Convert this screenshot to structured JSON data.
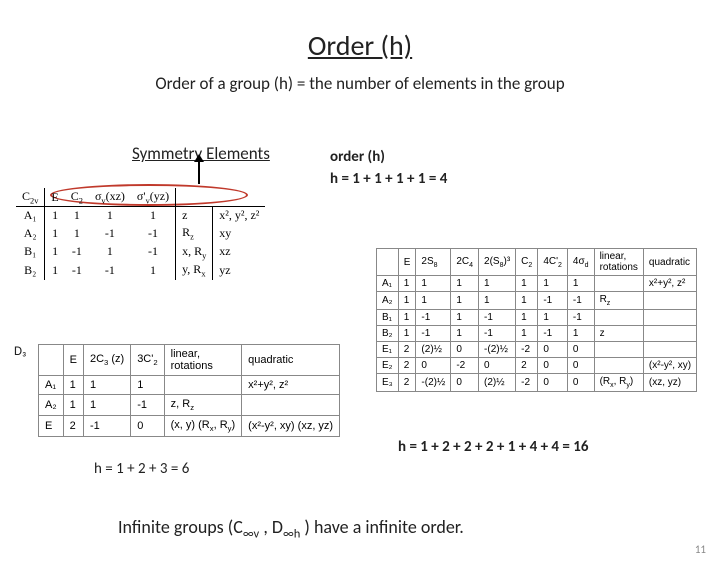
{
  "title": "Order (h)",
  "subtitle": "Order of a group (h) = the number of elements in the group",
  "sym_label": "Symmetry Elements",
  "order_label": "order (h)",
  "eq1": "h = 1 + 1 + 1 + 1 = 4",
  "d3_label": "D₃",
  "eq2": "h = 1 + 2 + 2 + 2 + 1 + 4 + 4 = 16",
  "eq3": "h = 1 + 2 + 3  = 6",
  "infinite_html": "Infinite groups (C<sub>∞v</sub> , D<sub>∞h</sub> ) have a infinite order.",
  "pagenum": "11",
  "c2v": {
    "hdr_html": [
      "C<sub>2v</sub>",
      "E",
      "C<sub>2</sub>",
      "σ<sub>v</sub>(xz)",
      "σ'<sub>v</sub>(yz)",
      "",
      ""
    ],
    "rows": [
      {
        "lbl": "A₁",
        "c": [
          "1",
          "1",
          "1",
          "1"
        ],
        "f1": "z",
        "f2": "x², y², z²"
      },
      {
        "lbl": "A₂",
        "c": [
          "1",
          "1",
          "-1",
          "-1"
        ],
        "f1": "R<sub>z</sub>",
        "f2": "xy"
      },
      {
        "lbl": "B₁",
        "c": [
          "1",
          "-1",
          "1",
          "-1"
        ],
        "f1": "x, R<sub>y</sub>",
        "f2": "xz"
      },
      {
        "lbl": "B₂",
        "c": [
          "1",
          "-1",
          "-1",
          "1"
        ],
        "f1": "y, R<sub>x</sub>",
        "f2": "yz"
      }
    ]
  },
  "d3": {
    "hdr_html": [
      "",
      "E",
      "2C<sub>3</sub> (z)",
      "3C'<sub>2</sub>",
      "linear,<br>rotations",
      "quadratic"
    ],
    "rows": [
      {
        "lbl": "A₁",
        "c": [
          "1",
          "1",
          "1"
        ],
        "f1": "",
        "f2": "x²+y², z²"
      },
      {
        "lbl": "A₂",
        "c": [
          "1",
          "1",
          "-1"
        ],
        "f1": "z, R<sub>z</sub>",
        "f2": ""
      },
      {
        "lbl": "E",
        "c": [
          "2",
          "-1",
          "0"
        ],
        "f1": "(x, y) (R<sub>x</sub>, R<sub>y</sub>)",
        "f2": "(x²-y², xy) (xz, yz)"
      }
    ]
  },
  "s8": {
    "hdr_html": [
      "",
      "E",
      "2S<sub>8</sub>",
      "2C<sub>4</sub>",
      "2(S<sub>8</sub>)³",
      "C<sub>2</sub>",
      "4C'<sub>2</sub>",
      "4σ<sub>d</sub>",
      "linear,<br>rotations",
      "quadratic"
    ],
    "rows": [
      {
        "lbl": "A₁",
        "c": [
          "1",
          "1",
          "1",
          "1",
          "1",
          "1",
          "1"
        ],
        "f1": "",
        "f2": "x²+y², z²"
      },
      {
        "lbl": "A₂",
        "c": [
          "1",
          "1",
          "1",
          "1",
          "1",
          "-1",
          "-1"
        ],
        "f1": "R<sub>z</sub>",
        "f2": ""
      },
      {
        "lbl": "B₁",
        "c": [
          "1",
          "-1",
          "1",
          "-1",
          "1",
          "1",
          "-1"
        ],
        "f1": "",
        "f2": ""
      },
      {
        "lbl": "B₂",
        "c": [
          "1",
          "-1",
          "1",
          "-1",
          "1",
          "-1",
          "1"
        ],
        "f1": "z",
        "f2": ""
      },
      {
        "lbl": "E₁",
        "c": [
          "2",
          "(2)½",
          "0",
          "-(2)½",
          "-2",
          "0",
          "0"
        ],
        "f1": "",
        "f2": ""
      },
      {
        "lbl": "E₂",
        "c": [
          "2",
          "0",
          "-2",
          "0",
          "2",
          "0",
          "0"
        ],
        "f1": "",
        "f2": "(x²-y², xy)"
      },
      {
        "lbl": "E₃",
        "c": [
          "2",
          "-(2)½",
          "0",
          "(2)½",
          "-2",
          "0",
          "0"
        ],
        "f1": "(R<sub>x</sub>, R<sub>y</sub>)",
        "f2": "(xz, yz)"
      }
    ]
  }
}
